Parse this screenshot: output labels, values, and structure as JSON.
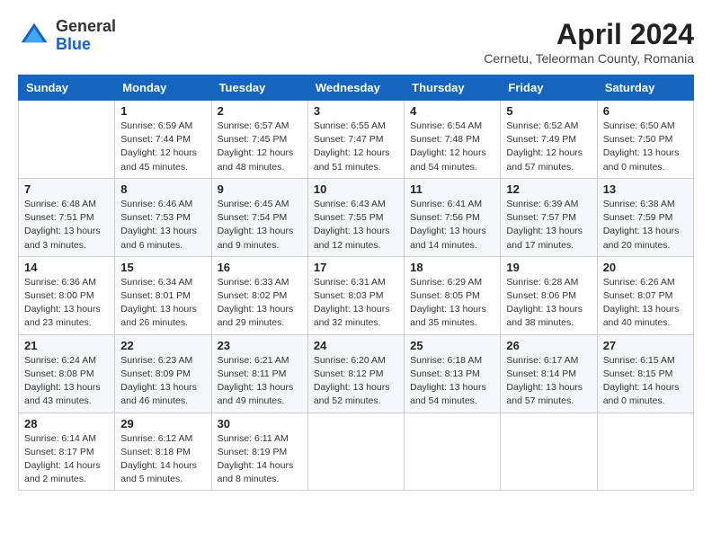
{
  "header": {
    "logo": {
      "general": "General",
      "blue": "Blue"
    },
    "title": "April 2024",
    "subtitle": "Cernetu, Teleorman County, Romania"
  },
  "calendar": {
    "weekdays": [
      "Sunday",
      "Monday",
      "Tuesday",
      "Wednesday",
      "Thursday",
      "Friday",
      "Saturday"
    ],
    "weeks": [
      [
        {
          "day": "",
          "info": ""
        },
        {
          "day": "1",
          "info": "Sunrise: 6:59 AM\nSunset: 7:44 PM\nDaylight: 12 hours\nand 45 minutes."
        },
        {
          "day": "2",
          "info": "Sunrise: 6:57 AM\nSunset: 7:45 PM\nDaylight: 12 hours\nand 48 minutes."
        },
        {
          "day": "3",
          "info": "Sunrise: 6:55 AM\nSunset: 7:47 PM\nDaylight: 12 hours\nand 51 minutes."
        },
        {
          "day": "4",
          "info": "Sunrise: 6:54 AM\nSunset: 7:48 PM\nDaylight: 12 hours\nand 54 minutes."
        },
        {
          "day": "5",
          "info": "Sunrise: 6:52 AM\nSunset: 7:49 PM\nDaylight: 12 hours\nand 57 minutes."
        },
        {
          "day": "6",
          "info": "Sunrise: 6:50 AM\nSunset: 7:50 PM\nDaylight: 13 hours\nand 0 minutes."
        }
      ],
      [
        {
          "day": "7",
          "info": "Sunrise: 6:48 AM\nSunset: 7:51 PM\nDaylight: 13 hours\nand 3 minutes."
        },
        {
          "day": "8",
          "info": "Sunrise: 6:46 AM\nSunset: 7:53 PM\nDaylight: 13 hours\nand 6 minutes."
        },
        {
          "day": "9",
          "info": "Sunrise: 6:45 AM\nSunset: 7:54 PM\nDaylight: 13 hours\nand 9 minutes."
        },
        {
          "day": "10",
          "info": "Sunrise: 6:43 AM\nSunset: 7:55 PM\nDaylight: 13 hours\nand 12 minutes."
        },
        {
          "day": "11",
          "info": "Sunrise: 6:41 AM\nSunset: 7:56 PM\nDaylight: 13 hours\nand 14 minutes."
        },
        {
          "day": "12",
          "info": "Sunrise: 6:39 AM\nSunset: 7:57 PM\nDaylight: 13 hours\nand 17 minutes."
        },
        {
          "day": "13",
          "info": "Sunrise: 6:38 AM\nSunset: 7:59 PM\nDaylight: 13 hours\nand 20 minutes."
        }
      ],
      [
        {
          "day": "14",
          "info": "Sunrise: 6:36 AM\nSunset: 8:00 PM\nDaylight: 13 hours\nand 23 minutes."
        },
        {
          "day": "15",
          "info": "Sunrise: 6:34 AM\nSunset: 8:01 PM\nDaylight: 13 hours\nand 26 minutes."
        },
        {
          "day": "16",
          "info": "Sunrise: 6:33 AM\nSunset: 8:02 PM\nDaylight: 13 hours\nand 29 minutes."
        },
        {
          "day": "17",
          "info": "Sunrise: 6:31 AM\nSunset: 8:03 PM\nDaylight: 13 hours\nand 32 minutes."
        },
        {
          "day": "18",
          "info": "Sunrise: 6:29 AM\nSunset: 8:05 PM\nDaylight: 13 hours\nand 35 minutes."
        },
        {
          "day": "19",
          "info": "Sunrise: 6:28 AM\nSunset: 8:06 PM\nDaylight: 13 hours\nand 38 minutes."
        },
        {
          "day": "20",
          "info": "Sunrise: 6:26 AM\nSunset: 8:07 PM\nDaylight: 13 hours\nand 40 minutes."
        }
      ],
      [
        {
          "day": "21",
          "info": "Sunrise: 6:24 AM\nSunset: 8:08 PM\nDaylight: 13 hours\nand 43 minutes."
        },
        {
          "day": "22",
          "info": "Sunrise: 6:23 AM\nSunset: 8:09 PM\nDaylight: 13 hours\nand 46 minutes."
        },
        {
          "day": "23",
          "info": "Sunrise: 6:21 AM\nSunset: 8:11 PM\nDaylight: 13 hours\nand 49 minutes."
        },
        {
          "day": "24",
          "info": "Sunrise: 6:20 AM\nSunset: 8:12 PM\nDaylight: 13 hours\nand 52 minutes."
        },
        {
          "day": "25",
          "info": "Sunrise: 6:18 AM\nSunset: 8:13 PM\nDaylight: 13 hours\nand 54 minutes."
        },
        {
          "day": "26",
          "info": "Sunrise: 6:17 AM\nSunset: 8:14 PM\nDaylight: 13 hours\nand 57 minutes."
        },
        {
          "day": "27",
          "info": "Sunrise: 6:15 AM\nSunset: 8:15 PM\nDaylight: 14 hours\nand 0 minutes."
        }
      ],
      [
        {
          "day": "28",
          "info": "Sunrise: 6:14 AM\nSunset: 8:17 PM\nDaylight: 14 hours\nand 2 minutes."
        },
        {
          "day": "29",
          "info": "Sunrise: 6:12 AM\nSunset: 8:18 PM\nDaylight: 14 hours\nand 5 minutes."
        },
        {
          "day": "30",
          "info": "Sunrise: 6:11 AM\nSunset: 8:19 PM\nDaylight: 14 hours\nand 8 minutes."
        },
        {
          "day": "",
          "info": ""
        },
        {
          "day": "",
          "info": ""
        },
        {
          "day": "",
          "info": ""
        },
        {
          "day": "",
          "info": ""
        }
      ]
    ]
  }
}
